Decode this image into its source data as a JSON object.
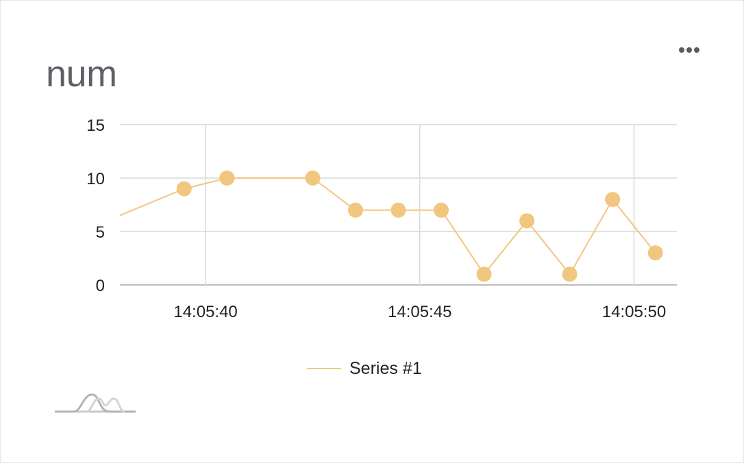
{
  "widget": {
    "title": "num",
    "menu_icon": "more-horizontal-icon",
    "logo_icon": "line-chart-logo-icon"
  },
  "colors": {
    "series": "#F1C67F",
    "grid": "#d9d9d9",
    "axis": "#bdbdbd",
    "text": "#222222",
    "title": "#5f5f66"
  },
  "chart_data": {
    "type": "line",
    "title": "",
    "xlabel": "",
    "ylabel": "",
    "ylim": [
      0,
      15
    ],
    "y_ticks": [
      "0",
      "5",
      "10",
      "15"
    ],
    "x_ticks": [
      "14:05:40",
      "14:05:45",
      "14:05:50"
    ],
    "x_range": [
      "14:05:38.0",
      "14:05:51.0"
    ],
    "grid": true,
    "legend_position": "bottom",
    "series": [
      {
        "name": "Series #1",
        "color": "#F1C67F",
        "points": [
          {
            "t": "14:05:38.0",
            "y": 6.5,
            "marker": false
          },
          {
            "t": "14:05:39.5",
            "y": 9
          },
          {
            "t": "14:05:40.5",
            "y": 10
          },
          {
            "t": "14:05:42.5",
            "y": 10
          },
          {
            "t": "14:05:43.5",
            "y": 7
          },
          {
            "t": "14:05:44.5",
            "y": 7
          },
          {
            "t": "14:05:45.5",
            "y": 7
          },
          {
            "t": "14:05:46.5",
            "y": 1
          },
          {
            "t": "14:05:47.5",
            "y": 6
          },
          {
            "t": "14:05:48.5",
            "y": 1
          },
          {
            "t": "14:05:49.5",
            "y": 8
          },
          {
            "t": "14:05:50.5",
            "y": 3
          }
        ]
      }
    ]
  }
}
